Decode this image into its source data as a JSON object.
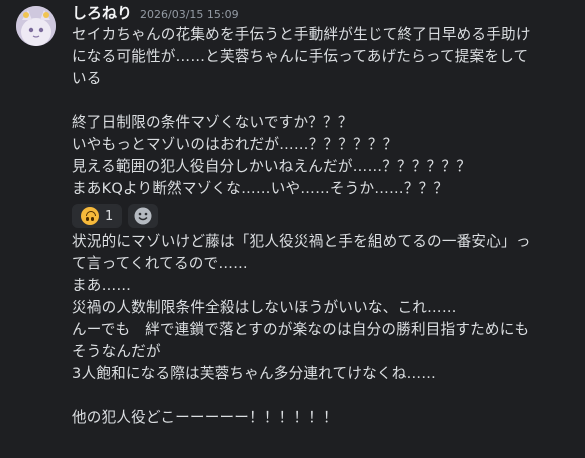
{
  "message": {
    "username": "しろねり",
    "timestamp": "2026/03/15 15:09",
    "lines_a": [
      "セイカちゃんの花集めを手伝うと手動絆が生じて終了日早める手助け",
      "になる可能性が……と芙蓉ちゃんに手伝ってあげたらって提案をして",
      "いる",
      "",
      "終了日制限の条件マゾくないですか？？？",
      "いやもっとマゾいのはおれだが……？？？？？？",
      "見える範囲の犯人役自分しかいねえんだが……？？？？？？",
      "まあKQより断然マゾくな……いや……そうか……？？？"
    ],
    "reactions": [
      {
        "emoji": "upside-down-face",
        "count": "1"
      }
    ],
    "add_reaction_icon": "add-reaction-icon",
    "lines_b": [
      "状況的にマゾいけど藤は「犯人役災禍と手を組めてるの一番安心」っ",
      "て言ってくれてるので……",
      "まあ……",
      "災禍の人数制限条件全殺はしないほうがいいな、これ……",
      "んーでも　絆で連鎖で落とすのが楽なのは自分の勝利目指すためにも",
      "そうなんだが",
      "3人飽和になる際は芙蓉ちゃん多分連れてけなくね……",
      "",
      "他の犯人役どこーーーーー！！！！！！"
    ]
  }
}
